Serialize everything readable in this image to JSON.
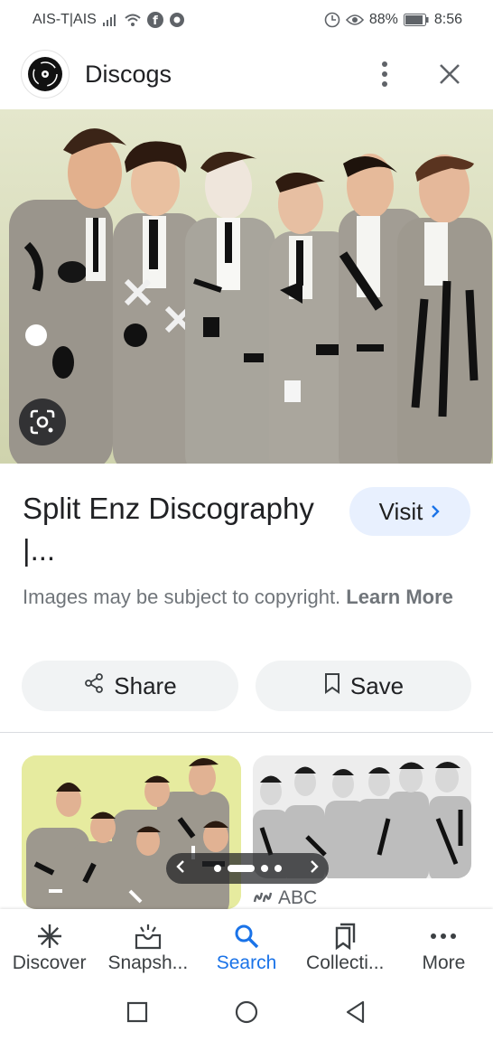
{
  "status_bar": {
    "carrier": "AIS-T|AIS",
    "battery": "88%",
    "time": "8:56"
  },
  "header": {
    "site_name": "Discogs",
    "logo_icon": "vinyl-record-icon",
    "menu_icon": "more-vert-icon",
    "close_icon": "close-icon"
  },
  "result": {
    "title": "Split Enz Discography |...",
    "visit_label": "Visit",
    "copyright_text": "Images may be subject to copyright.",
    "learn_more": "Learn More",
    "share_label": "Share",
    "save_label": "Save"
  },
  "related": {
    "source_name": "ABC"
  },
  "bottom_nav": [
    {
      "label": "Discover",
      "icon": "discover-asterisk-icon"
    },
    {
      "label": "Snapsh...",
      "icon": "snapshot-icon"
    },
    {
      "label": "Search",
      "icon": "search-icon",
      "active": true
    },
    {
      "label": "Collecti...",
      "icon": "collections-icon"
    },
    {
      "label": "More",
      "icon": "more-horiz-icon"
    }
  ],
  "colors": {
    "accent": "#1a73e8",
    "visit_bg": "#e8f0fe",
    "chip_bg": "#f1f3f4"
  }
}
